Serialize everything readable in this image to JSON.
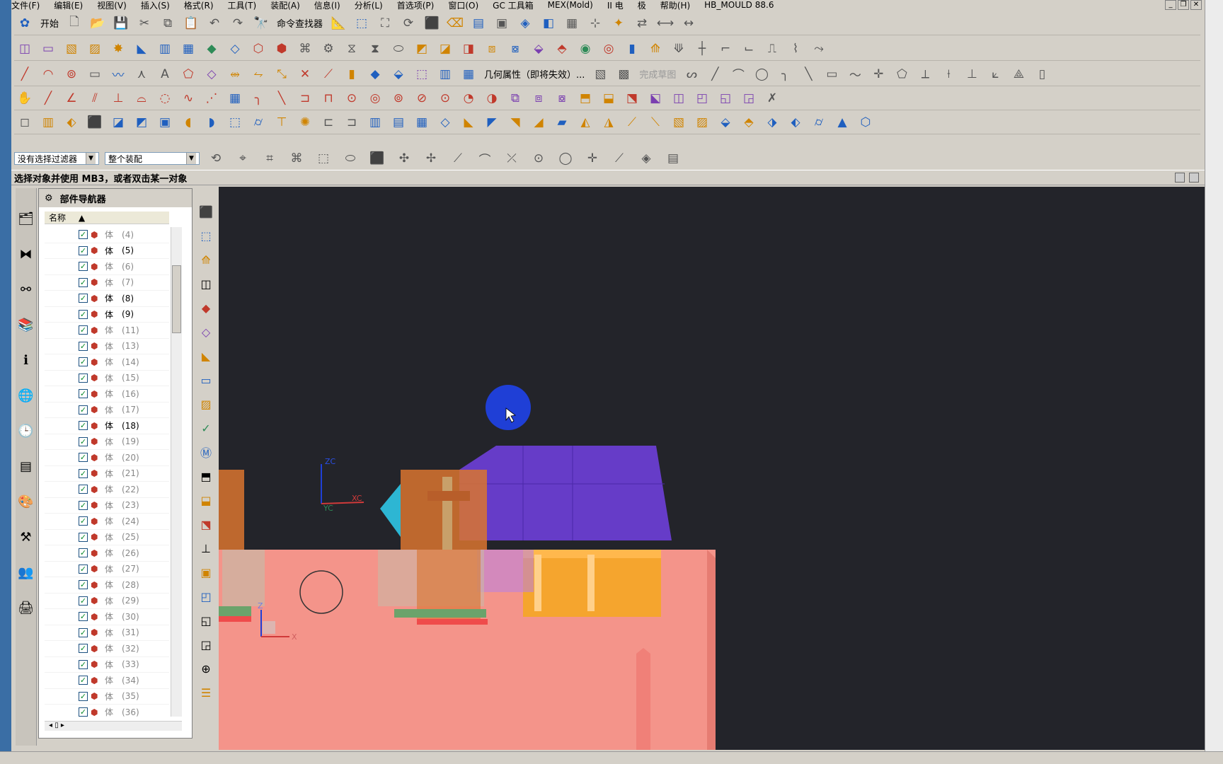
{
  "menu": [
    "文件(F)",
    "编辑(E)",
    "视图(V)",
    "插入(S)",
    "格式(R)",
    "工具(T)",
    "装配(A)",
    "信息(I)",
    "分析(L)",
    "首选项(P)",
    "窗口(O)",
    "GC 工具箱",
    "MEX(Mold)",
    "II 电",
    "极",
    "帮助(H)",
    "HB_MOULD 88.6"
  ],
  "toolbar": {
    "start_label": "开始",
    "cmd_finder_label": "命令查找器",
    "geom_props_label": "几何属性（即将失效）...",
    "finish_sketch_label": "完成草图"
  },
  "filter": {
    "selection_filter": "没有选择过滤器",
    "scope": "整个装配"
  },
  "status_message": "选择对象并使用 MB3，或者双击某一对象",
  "navigator": {
    "title": "部件导航器",
    "column_name": "名称",
    "rows": [
      {
        "label": "体",
        "num": "(4)",
        "dim": true
      },
      {
        "label": "体",
        "num": "(5)",
        "dim": false
      },
      {
        "label": "体",
        "num": "(6)",
        "dim": true
      },
      {
        "label": "体",
        "num": "(7)",
        "dim": true
      },
      {
        "label": "体",
        "num": "(8)",
        "dim": false
      },
      {
        "label": "体",
        "num": "(9)",
        "dim": false
      },
      {
        "label": "体",
        "num": "(11)",
        "dim": true
      },
      {
        "label": "体",
        "num": "(13)",
        "dim": true
      },
      {
        "label": "体",
        "num": "(14)",
        "dim": true
      },
      {
        "label": "体",
        "num": "(15)",
        "dim": true
      },
      {
        "label": "体",
        "num": "(16)",
        "dim": true
      },
      {
        "label": "体",
        "num": "(17)",
        "dim": true
      },
      {
        "label": "体",
        "num": "(18)",
        "dim": false
      },
      {
        "label": "体",
        "num": "(19)",
        "dim": true
      },
      {
        "label": "体",
        "num": "(20)",
        "dim": true
      },
      {
        "label": "体",
        "num": "(21)",
        "dim": true
      },
      {
        "label": "体",
        "num": "(22)",
        "dim": true
      },
      {
        "label": "体",
        "num": "(23)",
        "dim": true
      },
      {
        "label": "体",
        "num": "(24)",
        "dim": true
      },
      {
        "label": "体",
        "num": "(25)",
        "dim": true
      },
      {
        "label": "体",
        "num": "(26)",
        "dim": true
      },
      {
        "label": "体",
        "num": "(27)",
        "dim": true
      },
      {
        "label": "体",
        "num": "(28)",
        "dim": true
      },
      {
        "label": "体",
        "num": "(29)",
        "dim": true
      },
      {
        "label": "体",
        "num": "(30)",
        "dim": true
      },
      {
        "label": "体",
        "num": "(31)",
        "dim": true
      },
      {
        "label": "体",
        "num": "(32)",
        "dim": true
      },
      {
        "label": "体",
        "num": "(33)",
        "dim": true
      },
      {
        "label": "体",
        "num": "(34)",
        "dim": true
      },
      {
        "label": "体",
        "num": "(35)",
        "dim": true
      },
      {
        "label": "体",
        "num": "(36)",
        "dim": true
      }
    ]
  },
  "viewport": {
    "wcs_x": "XC",
    "wcs_y": "YC",
    "wcs_z": "ZC",
    "abs_x": "X",
    "abs_z": "Z",
    "colors": {
      "background": "#23242a",
      "plate": "#f4948a",
      "block": "#6c3fd6",
      "pins": "#f5a623",
      "marker": "#1f3fd6"
    }
  }
}
